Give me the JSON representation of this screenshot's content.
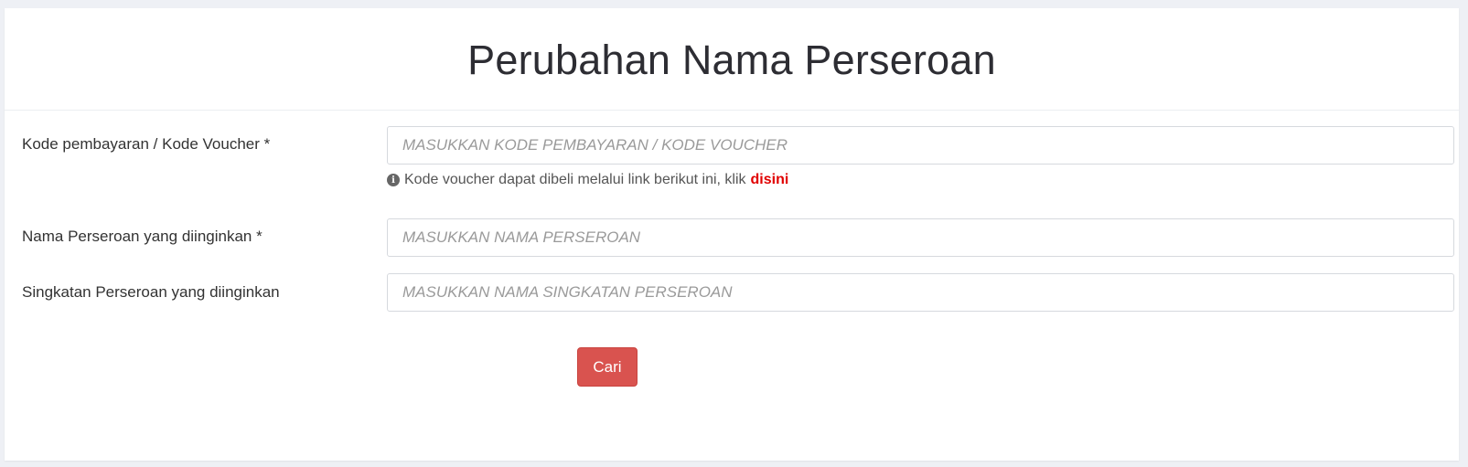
{
  "page": {
    "title": "Perubahan Nama Perseroan"
  },
  "form": {
    "voucher": {
      "label": "Kode pembayaran / Kode Voucher *",
      "placeholder": "MASUKKAN KODE PEMBAYARAN / KODE VOUCHER",
      "value": "",
      "help_text": "Kode voucher dapat dibeli melalui link berikut ini, klik",
      "help_link": "disini",
      "help_icon": "info-icon"
    },
    "company_name": {
      "label": "Nama Perseroan yang diinginkan *",
      "placeholder": "MASUKKAN NAMA PERSEROAN",
      "value": ""
    },
    "abbreviation": {
      "label": "Singkatan Perseroan yang diinginkan",
      "placeholder": "MASUKKAN NAMA SINGKATAN PERSEROAN",
      "value": ""
    },
    "submit_label": "Cari"
  },
  "colors": {
    "primary_button": "#d9534f",
    "link_red": "#e10000",
    "background": "#eef0f5"
  }
}
